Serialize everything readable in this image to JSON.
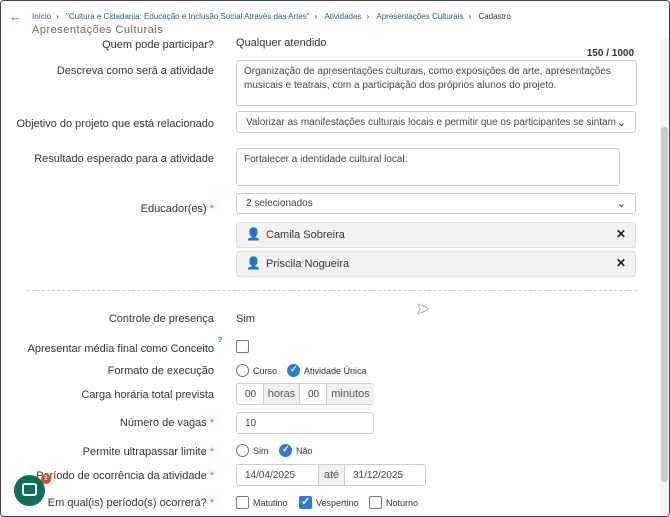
{
  "breadcrumb": {
    "items": [
      "Início",
      "\"Cultura e Cidadania: Educação e Inclusão Social Através das Artes\"",
      "Atividades",
      "Apresentações Culturais"
    ],
    "current": "Cadastro"
  },
  "page": {
    "title": "Apresentações Culturais"
  },
  "fields": {
    "who_can_participate": {
      "label": "Quem pode participar?",
      "value": "Qualquer atendido"
    },
    "description": {
      "label": "Descreva como será a atividade",
      "counter": "150 / 1000",
      "value": "Organização de apresentações culturais, como exposições de arte, apresentações musicais e teatrais, com a participação dos próprios alunos do projeto."
    },
    "objective": {
      "label": "Objetivo do projeto que está relacionado",
      "value": "Valorizar as manifestações culturais locais e permitir que os participantes se sintam"
    },
    "expected_result": {
      "label": "Resultado esperado para a atividade",
      "value": "Fortalecer a identidade cultural local:"
    },
    "educators": {
      "label": "Educador(es)",
      "required_mark": "*",
      "value": "2 selecionados",
      "selected": [
        "Camila Sobreira",
        "Priscila Nogueira"
      ]
    },
    "attendance": {
      "label": "Controle de presença",
      "value": "Sim"
    },
    "average_as_concept": {
      "label": "Apresentar média final como Conceito",
      "help": "?"
    },
    "execution_format": {
      "label": "Formato de execução",
      "options": [
        "Curso",
        "Atividade Única"
      ],
      "selected": "Atividade Única"
    },
    "workload": {
      "label": "Carga horária total prevista",
      "hours": "00",
      "hours_unit": "horas",
      "minutes": "00",
      "minutes_unit": "minutos"
    },
    "vacancies": {
      "label": "Número de vagas",
      "required_mark": "*",
      "value": "10"
    },
    "exceed_limit": {
      "label": "Permite ultrapassar limite",
      "required_mark": "*",
      "options": [
        "Sim",
        "Não"
      ],
      "selected": "Não"
    },
    "period": {
      "label": "Período de ocorrência da atividade",
      "required_mark": "*",
      "start": "14/04/2025",
      "separator": "até",
      "end": "31/12/2025"
    },
    "shifts": {
      "label": "Em qual(is) período(s) ocorrerá?",
      "required_mark": "*",
      "options": [
        "Matutino",
        "Vespertino",
        "Noturno"
      ],
      "selected": [
        "Vespertino"
      ]
    }
  },
  "chat": {
    "badge": "1"
  },
  "colors": {
    "accent": "#2b7bd6",
    "link": "#1a5fa6",
    "required": "#e4572e",
    "chat": "#0f6e5a"
  }
}
